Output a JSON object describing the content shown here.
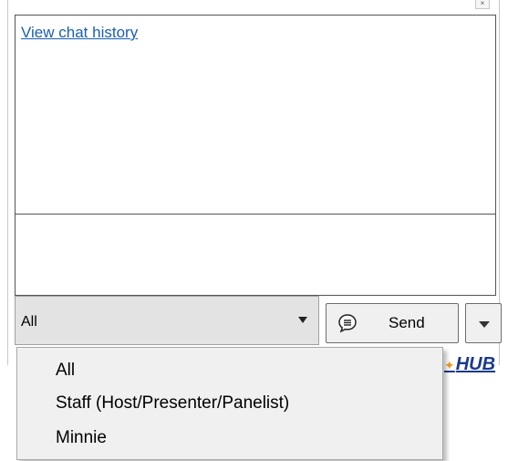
{
  "chat_panel": {
    "history_link": "View chat history",
    "input_value": ""
  },
  "recipient_select": {
    "selected": "All",
    "options": [
      "All",
      "Staff (Host/Presenter/Panelist)",
      "Minnie"
    ]
  },
  "send_button": {
    "label": "Send",
    "icon": "chat-bubble-icon"
  },
  "logo": {
    "text": "HUB"
  },
  "colors": {
    "link": "#1a5fb4",
    "menu_bg": "#f0f0f0",
    "select_bg": "#e3e3e3"
  }
}
